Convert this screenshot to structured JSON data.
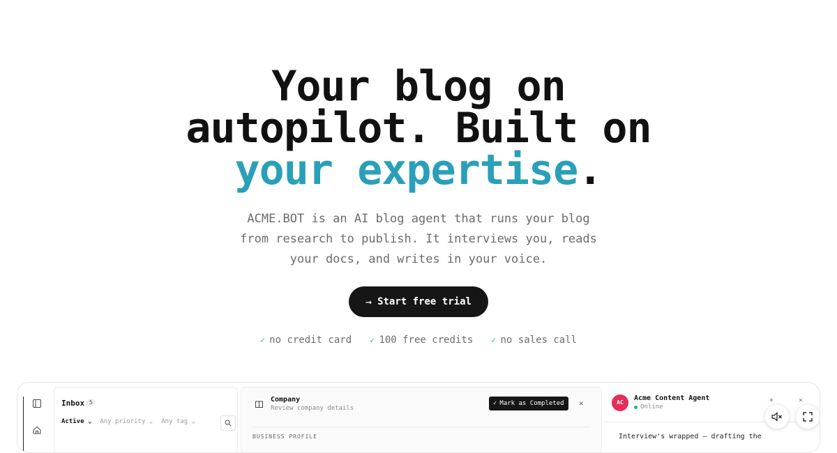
{
  "hero": {
    "headline": {
      "line1": "Your blog on",
      "line2": "autopilot. Built on",
      "line3_accent": "your expertise",
      "line3_end": "."
    },
    "subtitle": {
      "line1": "ACME.BOT is an AI blog agent that runs your blog",
      "line2": "from research to publish. It interviews you, reads",
      "line3": "your docs, and writes in your voice."
    },
    "cta": {
      "label": "Start free trial",
      "icon": "arrow-right-icon"
    },
    "perks": [
      {
        "label": "no credit card",
        "icon": "check-icon"
      },
      {
        "label": "100 free credits",
        "icon": "check-icon"
      },
      {
        "label": "no sales call",
        "icon": "check-icon"
      }
    ]
  },
  "preview": {
    "rail": {
      "icons": [
        "sidebar-toggle-icon",
        "home-icon"
      ]
    },
    "inbox": {
      "title": "Inbox",
      "count": "5",
      "filters": {
        "status": "Active",
        "priority": "Any priority",
        "tag": "Any tag"
      },
      "search_icon": "search-icon"
    },
    "company": {
      "title": "Company",
      "subtitle": "Review company details",
      "mark_completed": "Mark as Completed",
      "section_label": "BUSINESS PROFILE"
    },
    "agent": {
      "avatar_initials": "AC",
      "name": "Acme Content Agent",
      "status": "Online",
      "message": "Interview's wrapped — drafting the"
    },
    "floating": {
      "mute_icon": "mute-icon",
      "fullscreen_icon": "fullscreen-icon"
    }
  },
  "colors": {
    "accent": "#2aa0b8",
    "cta_bg": "#161616",
    "check": "#3fb6a0",
    "avatar": "#e62e5a",
    "online": "#22b573"
  }
}
